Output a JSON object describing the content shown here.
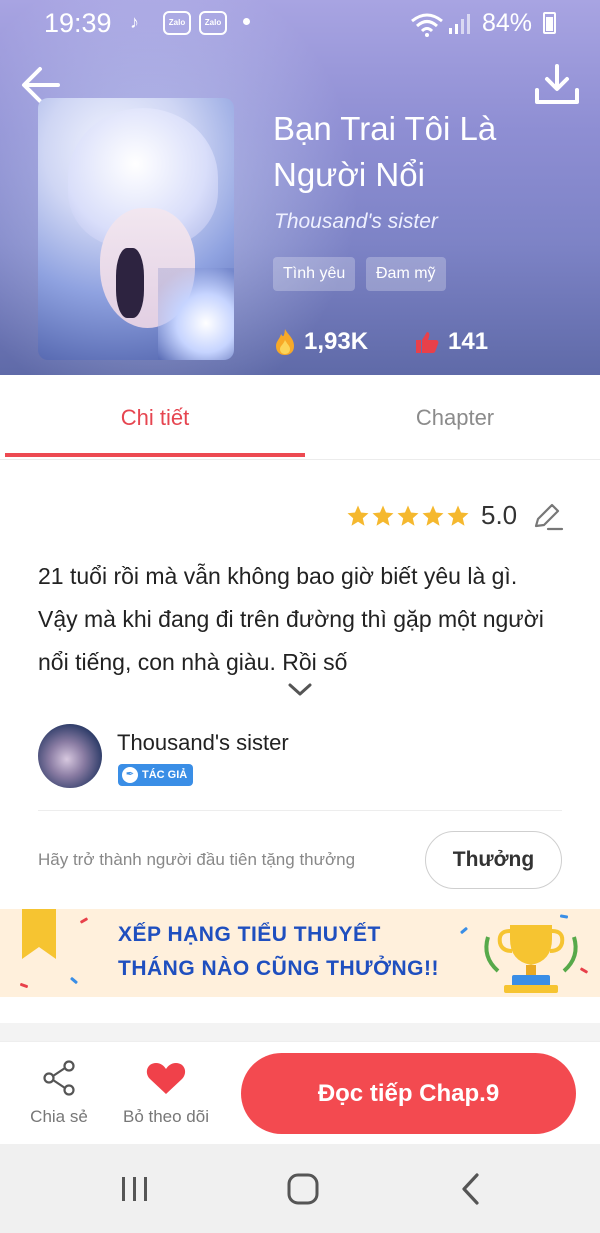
{
  "status_bar": {
    "time": "19:39",
    "notification_icons": [
      "tiktok-icon",
      "zalo-icon",
      "zalo-icon"
    ],
    "zalo_label": "Zalo",
    "battery": "84%"
  },
  "header": {
    "title": "Bạn Trai Tôi Là Người Nổi",
    "author": "Thousand's sister",
    "tags": [
      "Tình yêu",
      "Đam mỹ"
    ],
    "views": "1,93K",
    "likes": "141"
  },
  "tabs": [
    {
      "label": "Chi tiết",
      "active": true
    },
    {
      "label": "Chapter",
      "active": false
    }
  ],
  "details": {
    "rating": "5.0",
    "stars": 5,
    "description": "21 tuổi rồi mà vẫn không bao giờ biết yêu là gì. Vậy mà khi đang đi trên đường thì gặp một người nổi tiếng, con nhà giàu. Rồi số"
  },
  "author_card": {
    "name": "Thousand's sister",
    "badge": "TÁC GIẢ"
  },
  "gift": {
    "prompt": "Hãy trở thành người đầu tiên tặng thưởng",
    "button": "Thưởng"
  },
  "banner": {
    "line1": "XẾP HẠNG TIỂU THUYẾT",
    "line2": "THÁNG NÀO CŨNG THƯỞNG!!"
  },
  "bottom_bar": {
    "share": "Chia sẻ",
    "follow": "Bỏ theo dõi",
    "read": "Đọc tiếp Chap.9"
  },
  "colors": {
    "accent": "#ed4a52",
    "badge": "#3a8ee6",
    "star": "#f5b82e"
  }
}
